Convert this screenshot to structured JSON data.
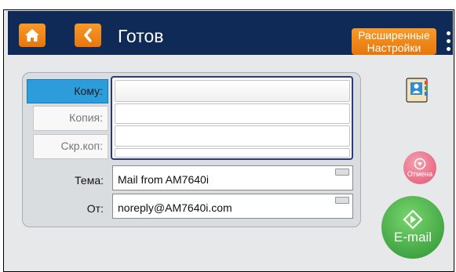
{
  "header": {
    "title": "Готов",
    "advanced_label_line1": "Расширенные",
    "advanced_label_line2": "Настройки"
  },
  "form": {
    "to_label": "Кому:",
    "cc_label": "Копия:",
    "bcc_label": "Скр.коп:",
    "subject_label": "Тема:",
    "subject_value": "Mail from AM7640i",
    "from_label": "От:",
    "from_value": "noreply@AM7640i.com"
  },
  "actions": {
    "cancel_label": "Отмена",
    "send_label": "E-mail"
  },
  "colors": {
    "header_bg": "#0f2a57",
    "orange_button": "#f28a1f",
    "selected_label": "#2d9cdb",
    "cancel_pink": "#e15673",
    "send_green": "#2d9233"
  },
  "icons": [
    "home-icon",
    "back-arrow-icon",
    "more-vertical-icon",
    "address-book-icon",
    "stop-icon",
    "send-icon",
    "keyboard-icon"
  ]
}
